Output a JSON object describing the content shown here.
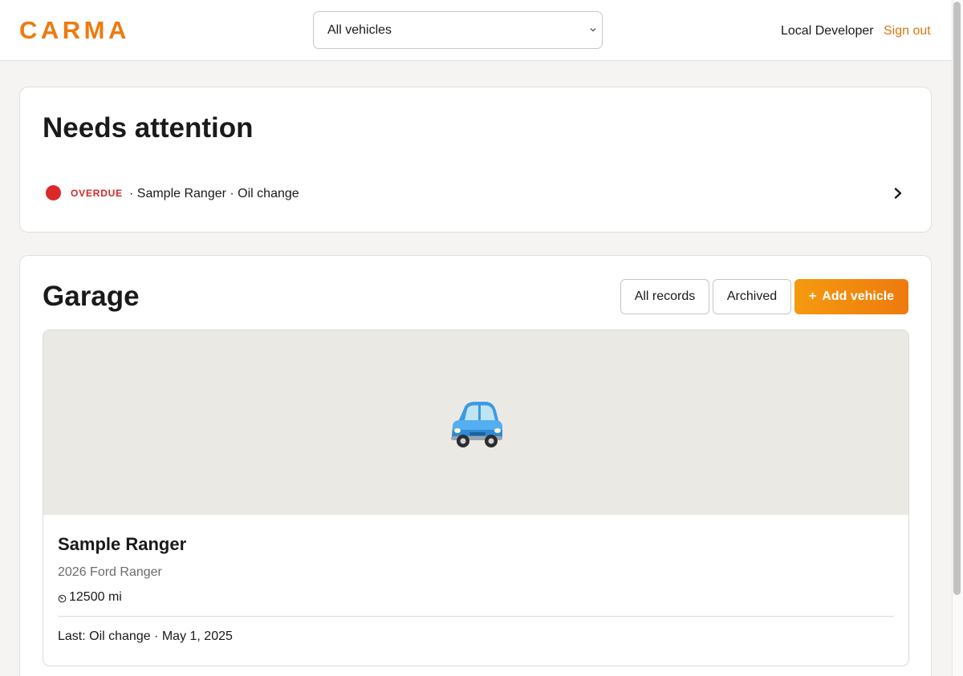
{
  "header": {
    "logo": "CARMA",
    "vehicle_filter": {
      "selected": "All vehicles"
    },
    "user_name": "Local Developer",
    "sign_out": "Sign out"
  },
  "attention": {
    "title": "Needs attention",
    "items": [
      {
        "status": "OVERDUE",
        "detail": "· Sample Ranger · Oil change",
        "status_color": "#dc2828"
      }
    ]
  },
  "garage": {
    "title": "Garage",
    "buttons": {
      "all_records": "All records",
      "archived": "Archived",
      "add_vehicle_icon": "+",
      "add_vehicle": "Add vehicle"
    },
    "vehicles": [
      {
        "photo_icon": "car-icon",
        "name": "Sample Ranger",
        "model": "2026 Ford Ranger",
        "odometer": "12500 mi",
        "last_service": "Last: Oil change · May 1, 2025"
      }
    ]
  },
  "colors": {
    "brand": "#ee7a11",
    "accent_link": "#d9770f",
    "overdue": "#dc2828",
    "page_bg": "#f5f4f2"
  }
}
